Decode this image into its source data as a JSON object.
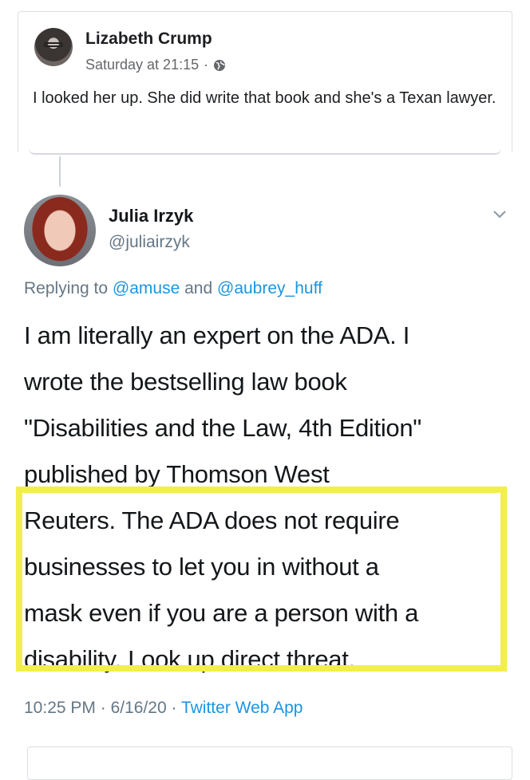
{
  "comment": {
    "author": "Lizabeth Crump",
    "time": "Saturday at 21:15",
    "separator": "·",
    "visibility_icon": "globe-icon",
    "text": "I looked her up. She did write that book and she's a Texan lawyer."
  },
  "tweet": {
    "name": "Julia Irzyk",
    "handle": "@juliairzyk",
    "reply_prefix": "Replying to",
    "reply_to_1": "@amuse",
    "reply_and": "and",
    "reply_to_2": "@aubrey_huff",
    "body_lines": [
      "I am literally an expert on the ADA. I",
      "wrote the bestselling law book",
      "\"Disabilities and the Law, 4th Edition\"",
      "published by Thomson West",
      "Reuters. The ADA does not require",
      "businesses to let you in without a",
      "mask even if you are a person with a",
      "disability. Look up direct threat."
    ],
    "time": "10:25 PM",
    "date": "6/16/20",
    "dot": "·",
    "source": "Twitter Web App",
    "highlight_color": "#f2ef4a",
    "link_color": "#1b95e0"
  }
}
